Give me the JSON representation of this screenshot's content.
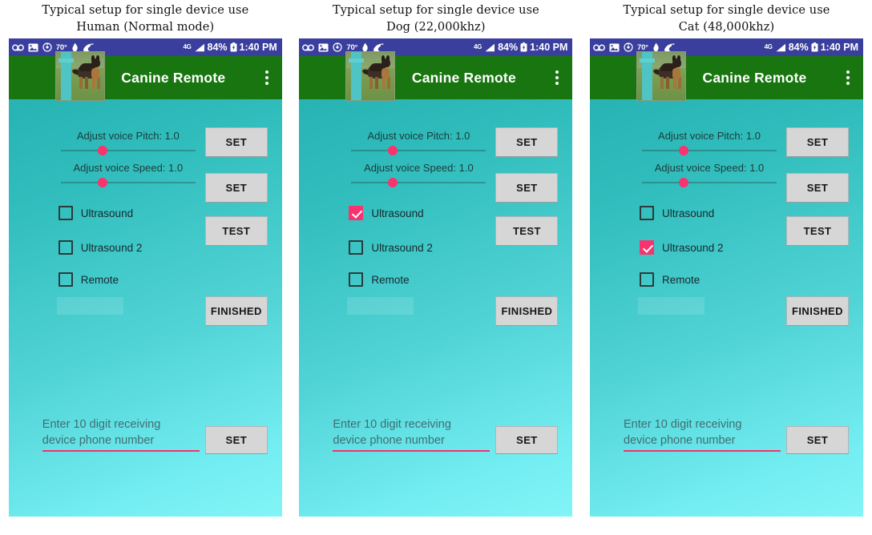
{
  "panels": [
    {
      "caption": "Typical setup for single device use\nHuman (Normal mode)",
      "status_bar": {
        "temperature": "70°",
        "network": "4G",
        "battery_percent": "84%",
        "time": "1:40 PM"
      },
      "app_bar": {
        "title": "Canine Remote"
      },
      "sliders": [
        {
          "label": "Adjust voice Pitch: 1.0",
          "button": "SET"
        },
        {
          "label": "Adjust voice Speed: 1.0",
          "button": "SET"
        }
      ],
      "checkboxes": [
        {
          "label": "Ultrasound",
          "checked": false
        },
        {
          "label": "Ultrasound 2",
          "checked": false
        },
        {
          "label": "Remote",
          "checked": false
        }
      ],
      "test_button": "TEST",
      "finished_button": "FINISHED",
      "phone_field": {
        "placeholder": "Enter 10 digit receiving\ndevice phone number",
        "value": "",
        "button": "SET"
      }
    },
    {
      "caption": "Typical setup for single device use\nDog (22,000khz)",
      "status_bar": {
        "temperature": "70°",
        "network": "4G",
        "battery_percent": "84%",
        "time": "1:40 PM"
      },
      "app_bar": {
        "title": "Canine Remote"
      },
      "sliders": [
        {
          "label": "Adjust voice Pitch: 1.0",
          "button": "SET"
        },
        {
          "label": "Adjust voice Speed: 1.0",
          "button": "SET"
        }
      ],
      "checkboxes": [
        {
          "label": "Ultrasound",
          "checked": true
        },
        {
          "label": "Ultrasound 2",
          "checked": false
        },
        {
          "label": "Remote",
          "checked": false
        }
      ],
      "test_button": "TEST",
      "finished_button": "FINISHED",
      "phone_field": {
        "placeholder": "Enter 10 digit receiving\ndevice phone number",
        "value": "",
        "button": "SET"
      }
    },
    {
      "caption": "Typical setup for single device use\nCat (48,000khz)",
      "status_bar": {
        "temperature": "70°",
        "network": "4G",
        "battery_percent": "84%",
        "time": "1:40 PM"
      },
      "app_bar": {
        "title": "Canine Remote"
      },
      "sliders": [
        {
          "label": "Adjust voice Pitch: 1.0",
          "button": "SET"
        },
        {
          "label": "Adjust voice Speed: 1.0",
          "button": "SET"
        }
      ],
      "checkboxes": [
        {
          "label": "Ultrasound",
          "checked": false
        },
        {
          "label": "Ultrasound 2",
          "checked": true
        },
        {
          "label": "Remote",
          "checked": false
        }
      ],
      "test_button": "TEST",
      "finished_button": "FINISHED",
      "phone_field": {
        "placeholder": "Enter 10 digit receiving\ndevice phone number",
        "value": "",
        "button": "SET"
      }
    }
  ],
  "colors": {
    "status_bar": "#3a3f9e",
    "app_bar": "#18750f",
    "accent_pink": "#f8336e",
    "button_face": "#d6d6d6",
    "background_top": "#24aeaf",
    "background_bottom": "#82f4f6"
  },
  "icons": {
    "status_left": [
      "voicemail-icon",
      "photo-icon",
      "target-icon",
      "temperature-label",
      "flame-icon",
      "wave-icon"
    ],
    "status_right": [
      "network-4g-icon",
      "signal-bars-icon",
      "battery-icon"
    ],
    "overflow": "overflow-menu-icon"
  }
}
